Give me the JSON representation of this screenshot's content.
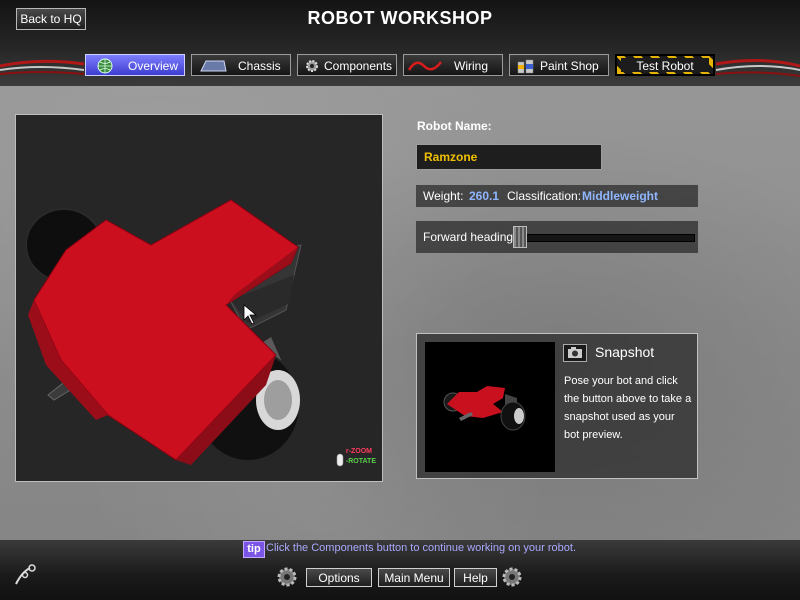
{
  "header": {
    "title": "ROBOT WORKSHOP",
    "back_label": "Back to HQ"
  },
  "tabs": [
    {
      "label": "Overview",
      "icon": "globe-icon",
      "active": true
    },
    {
      "label": "Chassis",
      "icon": "chassis-icon",
      "active": false
    },
    {
      "label": "Components",
      "icon": "gear-icon",
      "active": false
    },
    {
      "label": "Wiring",
      "icon": "wire-icon",
      "active": false
    },
    {
      "label": "Paint Shop",
      "icon": "paint-cans-icon",
      "active": false
    },
    {
      "label": "Test Robot",
      "icon": "",
      "active": false
    }
  ],
  "viewport": {
    "zoom_hint": "ZOOM",
    "rotate_hint": "ROTATE",
    "robot_color": "#cc0f1f"
  },
  "robot": {
    "name_label": "Robot Name:",
    "name": "Ramzone",
    "weight_label": "Weight:",
    "weight": "260.1",
    "class_label": "Classification:",
    "classification": "Middleweight",
    "heading_label": "Forward heading:",
    "heading_value": 0.0
  },
  "snapshot": {
    "title": "Snapshot",
    "description": "Pose your bot and click the button above to take a snapshot used as your bot preview."
  },
  "footer": {
    "tip_badge": "tip",
    "tip_text": "Click the Components button to continue working on your robot.",
    "options_label": "Options",
    "main_menu_label": "Main Menu",
    "help_label": "Help"
  },
  "colors": {
    "accent_blue": "#5a5aff",
    "name_text": "#f0c000",
    "value_text": "#8fb6ff",
    "tip_text": "#a9a9ff"
  }
}
